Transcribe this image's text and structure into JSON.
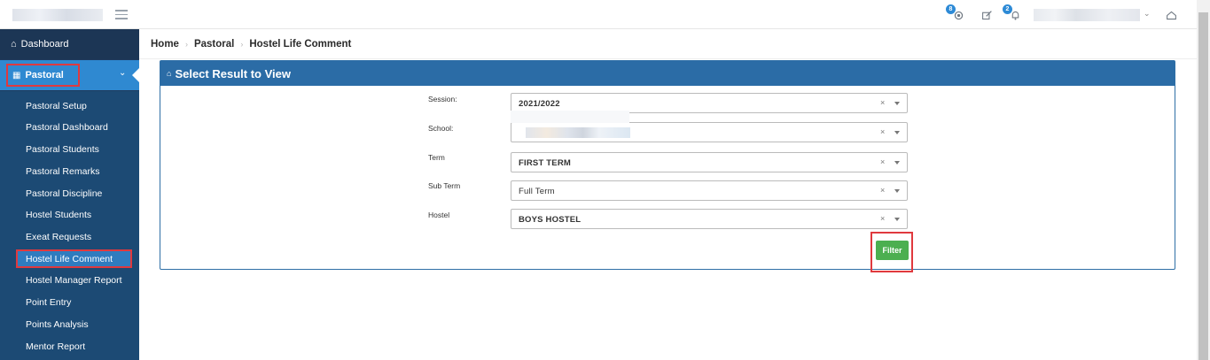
{
  "topbar": {
    "notifications_badge": "8",
    "messages_badge": "2",
    "icons": [
      "gear-icon",
      "edit-icon",
      "bell-icon",
      "user-caret-icon",
      "inbox-icon"
    ]
  },
  "sidebar": {
    "dashboard_label": "Dashboard",
    "pastoral_label": "Pastoral",
    "items": [
      {
        "label": "Pastoral Setup"
      },
      {
        "label": "Pastoral Dashboard"
      },
      {
        "label": "Pastoral Students"
      },
      {
        "label": "Pastoral Remarks"
      },
      {
        "label": "Pastoral Discipline"
      },
      {
        "label": "Hostel Students"
      },
      {
        "label": "Exeat Requests"
      },
      {
        "label": "Hostel Life Comment"
      },
      {
        "label": "Hostel Manager Report"
      },
      {
        "label": "Point Entry"
      },
      {
        "label": "Points Analysis"
      },
      {
        "label": "Mentor Report"
      }
    ],
    "active_item": "Hostel Life Comment"
  },
  "breadcrumb": [
    "Home",
    "Pastoral",
    "Hostel Life Comment"
  ],
  "panel": {
    "title": "Select Result to View",
    "fields": [
      {
        "label": "Session:",
        "value": "2021/2022"
      },
      {
        "label": "School:",
        "value": ""
      },
      {
        "label": "Term",
        "value": "FIRST TERM"
      },
      {
        "label": "Sub Term",
        "value": "Full Term"
      },
      {
        "label": "Hostel",
        "value": "BOYS HOSTEL"
      }
    ],
    "clear_symbol": "×",
    "filter_label": "Filter"
  },
  "colors": {
    "sidebar_bg": "#1e3a5c",
    "active_blue": "#2f89d1",
    "panel_head": "#2b6ca6",
    "filter_green": "#4caf50",
    "highlight_red": "#e0393e"
  }
}
